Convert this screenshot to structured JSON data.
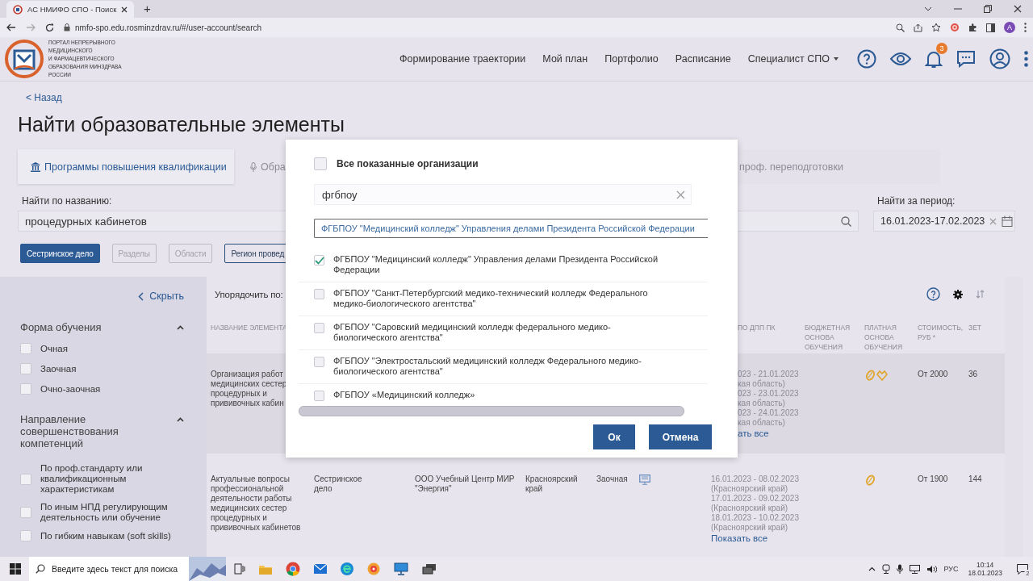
{
  "browser": {
    "tab_title": "АС НМИФО СПО - Поиск",
    "new_tab": "+",
    "url": "nmfo-spo.edu.rosminzdrav.ru/#/user-account/search",
    "profile": "A"
  },
  "header": {
    "logo_lines": [
      "ПОРТАЛ НЕПРЕРЫВНОГО",
      "МЕДИЦИНСКОГО",
      "И ФАРМАЦЕВТИЧЕСКОГО",
      "ОБРАЗОВАНИЯ МИНЗДРАВА РОССИИ"
    ],
    "nav": [
      {
        "label": "Формирование траектории",
        "dropdown": false
      },
      {
        "label": "Мой план",
        "dropdown": false
      },
      {
        "label": "Портфолио",
        "dropdown": false
      },
      {
        "label": "Расписание",
        "dropdown": false
      },
      {
        "label": "Специалист СПО",
        "dropdown": true
      }
    ],
    "notifications": "3"
  },
  "back_link": "< Назад",
  "page_title": "Найти образовательные элементы",
  "tabs": [
    {
      "label": "Программы повышения квалификации",
      "selected": true
    },
    {
      "label": "Обра",
      "selected": false
    },
    {
      "label": "проф. переподготовки",
      "selected": false
    }
  ],
  "search": {
    "label": "Найти по названию:",
    "value": "процедурных кабинетов"
  },
  "period": {
    "label": "Найти за период:",
    "value": "16.01.2023-17.02.2023"
  },
  "filters": [
    {
      "label": "Сестринское дело",
      "selected": true,
      "disabled": false
    },
    {
      "label": "Разделы",
      "selected": false,
      "disabled": true
    },
    {
      "label": "Области",
      "selected": false,
      "disabled": true
    },
    {
      "label": "Регион провед",
      "selected": false,
      "disabled": false
    }
  ],
  "sidebar": {
    "hide_link": "Скрыть",
    "sections": [
      {
        "title": "Форма обучения",
        "expanded": true,
        "options": [
          {
            "label": "Очная",
            "checked": false
          },
          {
            "label": "Заочная",
            "checked": false
          },
          {
            "label": "Очно-заочная",
            "checked": false
          }
        ]
      },
      {
        "title": "Направление совершенствования компетенций",
        "expanded": true,
        "options": [
          {
            "label": "По проф.стандарту или квалификационным характеристикам",
            "checked": false
          },
          {
            "label": "По иным НПД регулирующим деятельность или обучение",
            "checked": false
          },
          {
            "label": "По гибким навыкам (soft skills)",
            "checked": false
          }
        ]
      }
    ]
  },
  "results": {
    "sort_label": "Упорядочить по:",
    "columns": [
      {
        "label": "НАЗВАНИЕ ЭЛЕМЕНТА"
      },
      {
        "label": "ПО ДПП ПК"
      },
      {
        "label": "БЮДЖЕТНАЯ ОСНОВА ОБУЧЕНИЯ"
      },
      {
        "label": "ПЛАТНАЯ ОСНОВА ОБУЧЕНИЯ"
      },
      {
        "label": "СТОИМОСТЬ, РУБ *"
      },
      {
        "label": "ЗЕТ"
      }
    ],
    "rows": [
      {
        "selected": true,
        "name": "Организация работ\nмедицинских сестер\nпроцедурных и\nпрививочных кабин",
        "dates": "023 - 21.01.2023\nкая область)\n023 - 23.01.2023\nкая область)\n023 - 24.01.2023\nкая область)",
        "show_all": "ать все",
        "paid": [
          {
            "kind": "coin"
          },
          {
            "kind": "handshake"
          }
        ],
        "price": "От 2000",
        "zet": "36"
      },
      {
        "selected": false,
        "name": "Актуальные вопросы\nпрофессиональной\nдеятельности работы\nмедицинских сестер\nпроцедурных и\nпрививочных кабинетов",
        "specialty": "Сестринское\nдело",
        "organization": "ООО Учебный Центр МИР\n\"Энергия\"",
        "region": "Красноярский\nкрай",
        "form": "Заочная",
        "online": true,
        "dates": "16.01.2023 - 08.02.2023\n(Красноярский край)\n17.01.2023 - 09.02.2023\n(Красноярский край)\n18.01.2023 - 10.02.2023\n(Красноярский край)",
        "show_all": "Показать все",
        "paid": [
          {
            "kind": "coin"
          }
        ],
        "price": "От 1900",
        "zet": "144"
      }
    ]
  },
  "modal": {
    "select_all": {
      "label": "Все показанные организации",
      "checked": false
    },
    "search_value": "фгбпоу",
    "chip": "ФГБПОУ \"Медицинский колледж\" Управления делами Президента Российской Федерации",
    "options": [
      {
        "label": "ФГБПОУ \"Медицинский колледж\" Управления делами Президента Российской Федерации",
        "checked": true
      },
      {
        "label": "ФГБПОУ \"Санкт-Петербургский медико-технический колледж Федерального медико-биологического агентства\"",
        "checked": false
      },
      {
        "label": "ФГБПОУ \"Саровский медицинский колледж федерального медико-биологического агентства\"",
        "checked": false
      },
      {
        "label": "ФГБПОУ \"Электростальский медицинский колледж Федерального медико-биологического агентства\"",
        "checked": false
      },
      {
        "label": "ФГБПОУ «Медицинский колледж»",
        "checked": false
      }
    ],
    "buttons": [
      {
        "label": "Ок",
        "kind": "ok"
      },
      {
        "label": "Отмена",
        "kind": "cancel"
      }
    ]
  },
  "taskbar": {
    "search_placeholder": "Введите здесь текст для поиска",
    "language": "РУС",
    "time": "10:14",
    "date": "18.01.2023",
    "notifications": "2"
  }
}
